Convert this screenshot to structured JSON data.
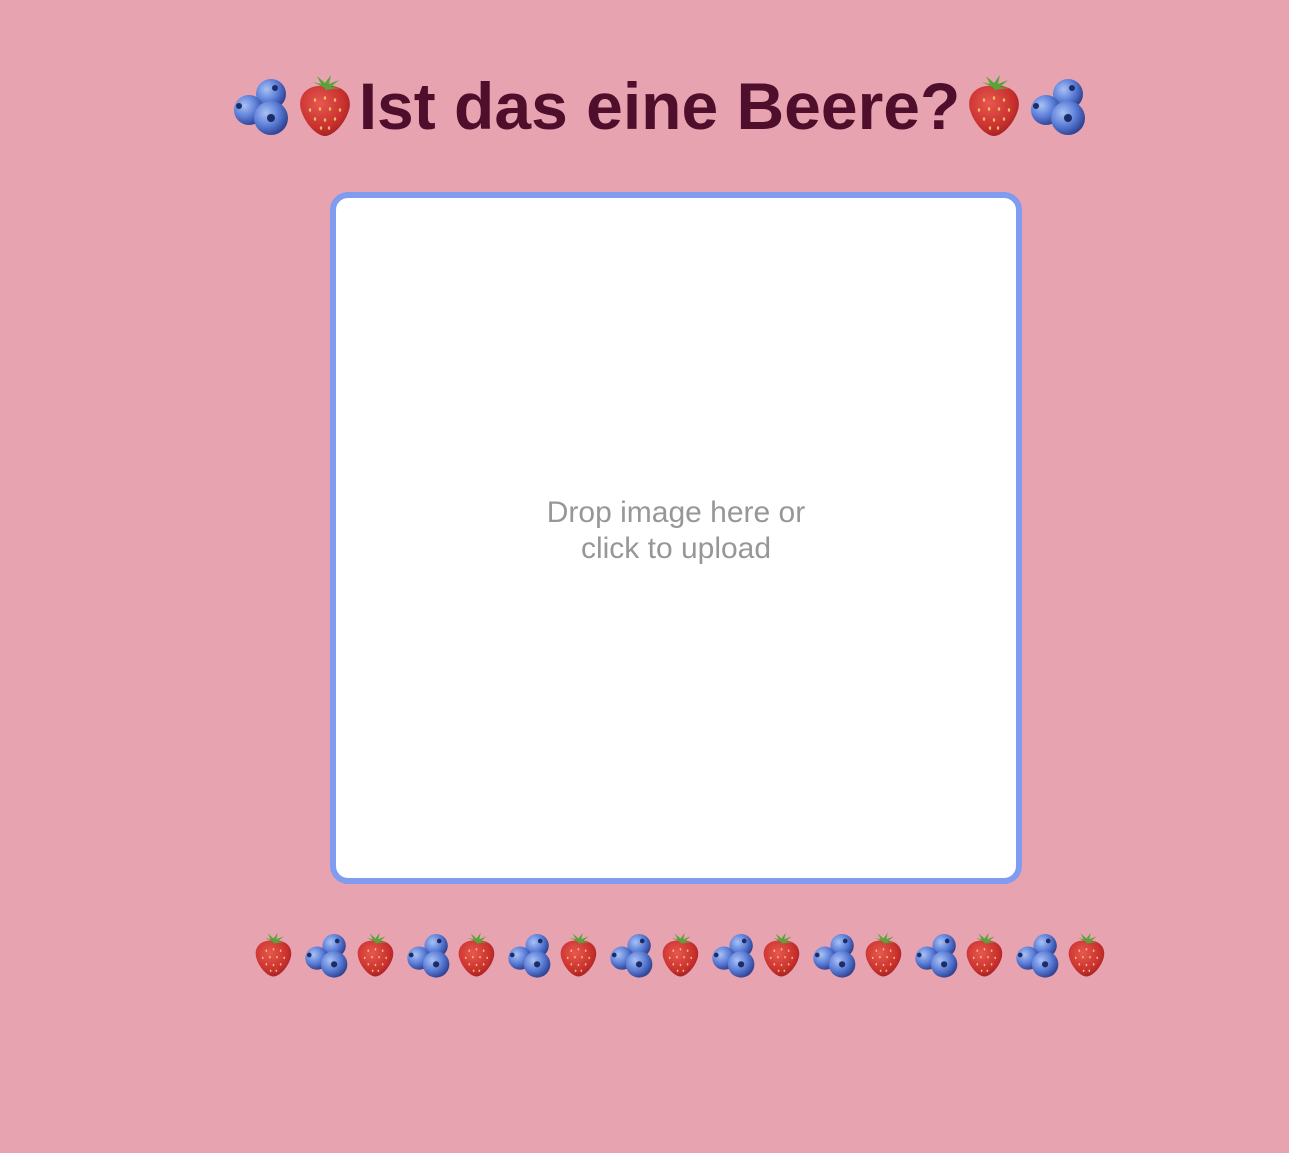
{
  "header": {
    "title": "Ist das eine Beere?",
    "left_icons": [
      "blueberry-icon",
      "strawberry-icon"
    ],
    "right_icons": [
      "strawberry-icon",
      "blueberry-icon"
    ]
  },
  "dropzone": {
    "text": "Drop image here or click to upload",
    "border_color": "#7f9cf0",
    "text_color": "#979797"
  },
  "footer": {
    "icons": [
      "strawberry-icon",
      "blueberry-icon",
      "strawberry-icon",
      "blueberry-icon",
      "strawberry-icon",
      "blueberry-icon",
      "strawberry-icon",
      "blueberry-icon",
      "strawberry-icon",
      "blueberry-icon",
      "strawberry-icon",
      "blueberry-icon",
      "strawberry-icon",
      "blueberry-icon",
      "strawberry-icon",
      "blueberry-icon",
      "strawberry-icon"
    ]
  },
  "colors": {
    "background": "#e8a3b0",
    "title": "#4e0e2c",
    "dropzone_bg": "#ffffff"
  }
}
